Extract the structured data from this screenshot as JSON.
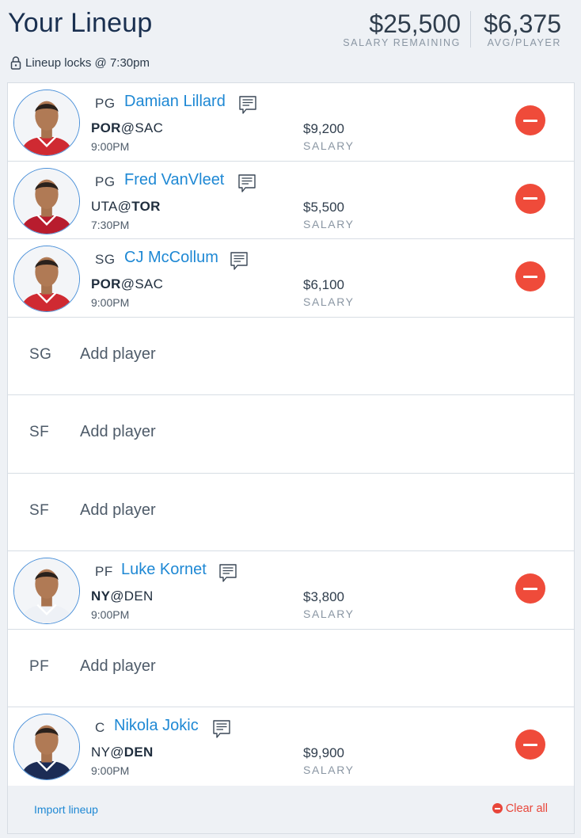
{
  "header": {
    "title": "Your Lineup",
    "lock_text": "Lineup locks @ 7:30pm",
    "salary_remaining": "$25,500",
    "salary_remaining_label": "SALARY REMAINING",
    "avg_player": "$6,375",
    "avg_player_label": "AVG/PLAYER"
  },
  "salary_label": "SALARY",
  "add_player_label": "Add player",
  "players": [
    {
      "pos": "PG",
      "name": "Damian Lillard",
      "away": "POR",
      "home": "SAC",
      "bold": "away",
      "time": "9:00PM",
      "salary": "$9,200",
      "jersey": "#cf2a32"
    },
    {
      "pos": "PG",
      "name": "Fred VanVleet",
      "away": "UTA",
      "home": "TOR",
      "bold": "home",
      "time": "7:30PM",
      "salary": "$5,500",
      "jersey": "#b81c2e"
    },
    {
      "pos": "SG",
      "name": "CJ McCollum",
      "away": "POR",
      "home": "SAC",
      "bold": "away",
      "time": "9:00PM",
      "salary": "$6,100",
      "jersey": "#cf2a32"
    },
    {
      "pos": "PF",
      "name": "Luke Kornet",
      "away": "NY",
      "home": "DEN",
      "bold": "away",
      "time": "9:00PM",
      "salary": "$3,800",
      "jersey": "#eef1f6"
    },
    {
      "pos": "C",
      "name": "Nikola Jokic",
      "away": "NY",
      "home": "DEN",
      "bold": "home",
      "time": "9:00PM",
      "salary": "$9,900",
      "jersey": "#1c2c55"
    }
  ],
  "empty_slots": [
    {
      "pos": "SG"
    },
    {
      "pos": "SF"
    },
    {
      "pos": "SF"
    },
    {
      "pos": "PF"
    }
  ],
  "footer": {
    "import_label": "Import lineup",
    "clear_label": "Clear all"
  },
  "colors": {
    "accent": "#1e88d4",
    "remove": "#ef4b3a",
    "background": "#eef1f5"
  }
}
